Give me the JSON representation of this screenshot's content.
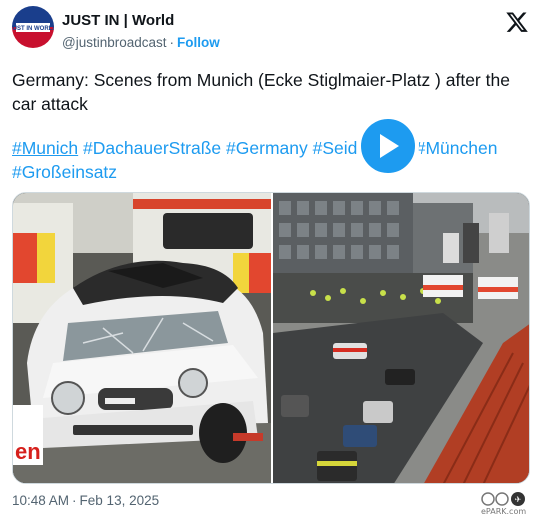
{
  "account": {
    "name": "JUST IN | World",
    "handle": "@justinbroadcast",
    "separator": "·",
    "follow_label": "Follow",
    "avatar_text_line1": "JUST IN",
    "avatar_text_line2": "WORLD"
  },
  "tweet": {
    "text": "Germany: Scenes from Munich (Ecke Stiglmaier-Platz ) after the car attack",
    "hashtags": [
      "#Munich",
      "#DachauerStraße",
      "#Germany",
      "#Seidlstraße",
      "#München",
      "#Großeinsatz"
    ]
  },
  "media": {
    "left_image": "damaged-white-mini-car-photo",
    "right_image": "street-scene-emergency-vehicles-video",
    "partial_caption": "en",
    "play_icon": "play-icon"
  },
  "footer": {
    "time": "10:48 AM",
    "separator": "·",
    "date": "Feb 13, 2025"
  },
  "icons": {
    "platform_logo": "x-logo-icon",
    "watermark": "watermark-icon"
  },
  "watermark_text": "ePARK.com",
  "colors": {
    "accent": "#1d9bf0",
    "text": "#0f1419",
    "muted": "#536471"
  }
}
